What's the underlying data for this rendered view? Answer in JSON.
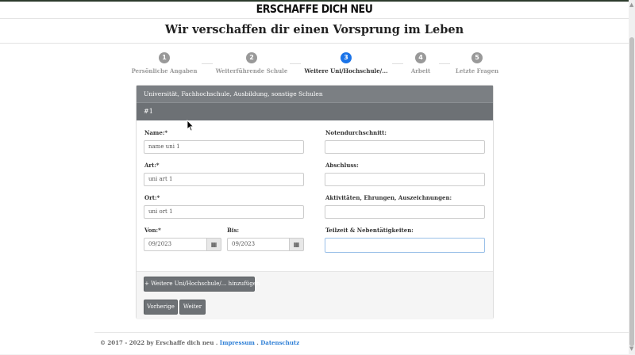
{
  "brand": "ERSCHAFFE DICH NEU",
  "hero_title": "Wir verschaffen dir einen Vorsprung im Leben",
  "steps": [
    {
      "num": "1",
      "label": "Persönliche Angaben",
      "active": false
    },
    {
      "num": "2",
      "label": "Weiterführende Schule",
      "active": false
    },
    {
      "num": "3",
      "label": "Weitere Uni/Hochschule/...",
      "active": true
    },
    {
      "num": "4",
      "label": "Arbeit",
      "active": false
    },
    {
      "num": "5",
      "label": "Letzte Fragen",
      "active": false
    }
  ],
  "card": {
    "title": "Universität, Fachhochschule, Ausbildung, sonstige Schulen",
    "entry": "#1"
  },
  "form": {
    "name_label": "Name:*",
    "name_value": "name uni 1",
    "art_label": "Art:*",
    "art_value": "uni art 1",
    "ort_label": "Ort:*",
    "ort_value": "uni ort 1",
    "von_label": "Von:*",
    "von_value": "09/2023",
    "bis_label": "Bis:",
    "bis_value": "09/2023",
    "noten_label": "Notendurchschnitt:",
    "noten_value": "",
    "abschluss_label": "Abschluss:",
    "abschluss_value": "",
    "aktiv_label": "Aktivitäten, Ehrungen, Auszeichnungen:",
    "aktiv_value": "",
    "teilzeit_label": "Teilzeit & Nebentätigkeiten:",
    "teilzeit_value": ""
  },
  "buttons": {
    "add": "+ Weitere Uni/Hochschule/... hinzufügen",
    "prev": "Vorherige",
    "next": "Weiter"
  },
  "footer": {
    "copyright": "© 2017 - 2022 by Erschaffe dich neu .",
    "impressum": "Impressum",
    "sep": ".",
    "datenschutz": "Datenschutz"
  },
  "icons": {
    "calendar": "calendar-icon",
    "cursor": "mouse-cursor-icon"
  },
  "colors": {
    "active_step": "#1a73e8",
    "card_header": "#7b7f83",
    "link": "#2e7fd6"
  }
}
